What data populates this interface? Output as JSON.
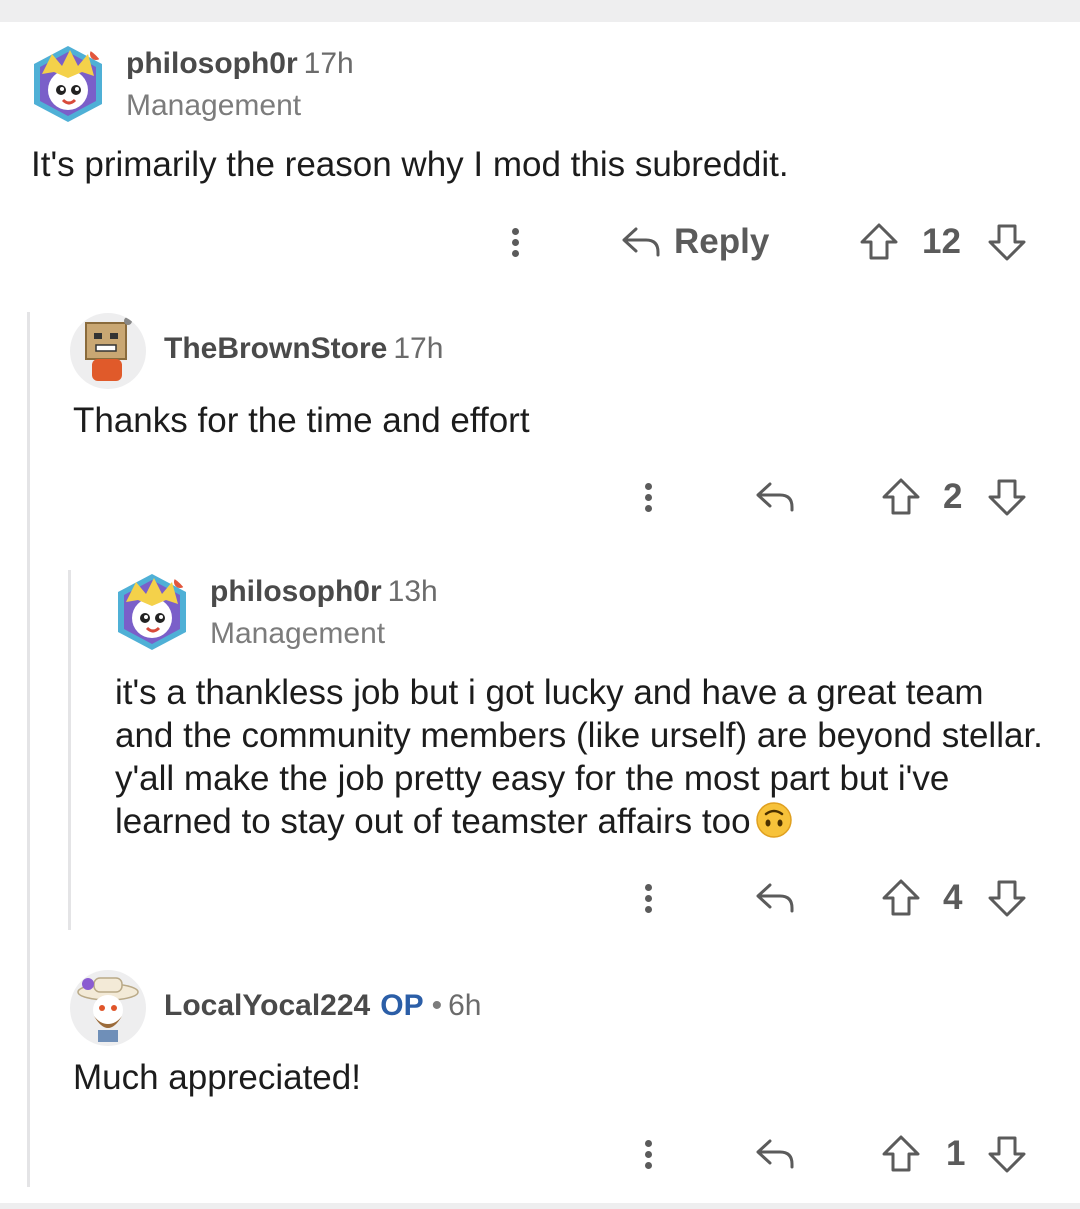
{
  "comments": [
    {
      "username": "philosoph0r",
      "age": "17h",
      "flair": "Management",
      "body": "It's primarily the reason why I mod this subreddit.",
      "reply_label": "Reply",
      "score": "12",
      "avatar_icon": "snoo-blonde-avatar-icon"
    },
    {
      "username": "TheBrownStore",
      "age": "17h",
      "body": "Thanks for the time and effort",
      "score": "2",
      "avatar_icon": "snoo-box-head-avatar-icon"
    },
    {
      "username": "philosoph0r",
      "age": "13h",
      "flair": "Management",
      "body": "it's a thankless job but i got lucky and have a great team and the community members (like urself) are beyond stellar. y'all make the job pretty easy for the most part but i've learned to stay out of teamster affairs too",
      "emoji": "upside-down-face-emoji",
      "score": "4",
      "avatar_icon": "snoo-blonde-avatar-icon"
    },
    {
      "username": "LocalYocal224",
      "op_badge": "OP",
      "separator": "•",
      "age": "6h",
      "body": "Much appreciated!",
      "score": "1",
      "avatar_icon": "snoo-sunhat-avatar-icon"
    }
  ],
  "colors": {
    "text": "#1c1c1c",
    "meta": "#6b6b6b",
    "action": "#5b5b5b",
    "op": "#2b5ea7",
    "thread_line": "#e4e4e6"
  }
}
